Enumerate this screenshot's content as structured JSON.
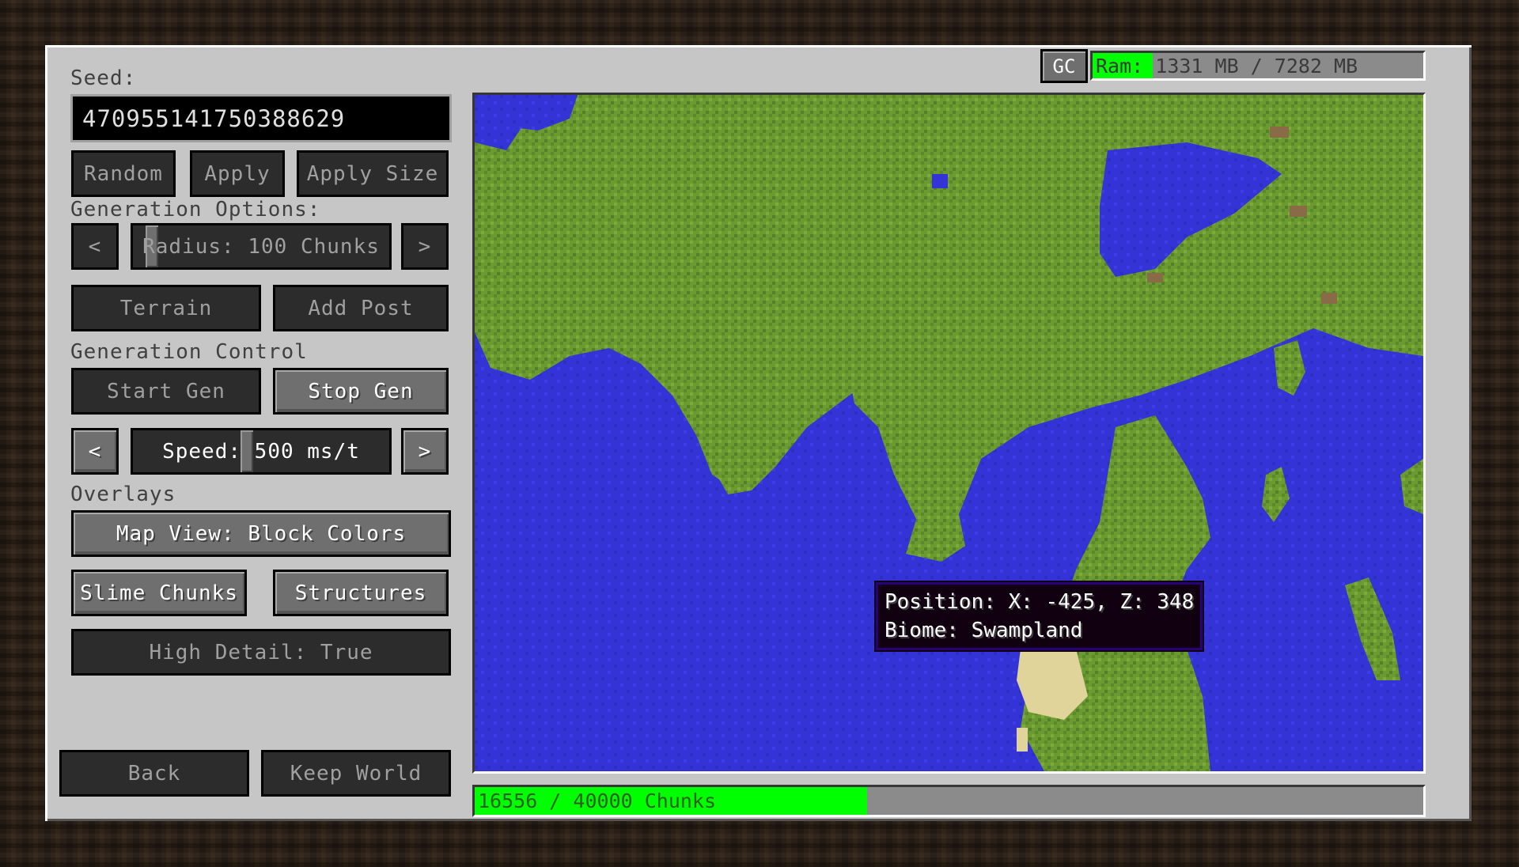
{
  "seed": {
    "label": "Seed:",
    "value": "4709551417503886​29"
  },
  "seed_buttons": {
    "random": "Random",
    "apply": "Apply",
    "apply_size": "Apply Size"
  },
  "generation_options": {
    "label": "Generation Options:",
    "prev": "<",
    "next": ">",
    "radius_label": "Radius: 100 Chunks",
    "radius_slider_fraction": 0.05,
    "terrain": "Terrain",
    "add_post": "Add Post"
  },
  "generation_control": {
    "label": "Generation Control",
    "start": "Start Gen",
    "stop": "Stop Gen",
    "prev": "<",
    "next": ">",
    "speed_label": "Speed: 500 ms/t",
    "speed_slider_fraction": 0.42
  },
  "overlays": {
    "label": "Overlays",
    "map_view": "Map View: Block Colors",
    "slime_chunks": "Slime Chunks",
    "structures": "Structures",
    "high_detail": "High Detail: True"
  },
  "footer": {
    "back": "Back",
    "keep_world": "Keep World"
  },
  "memory": {
    "gc_label": "GC",
    "ram_label": "Ram:",
    "ram_text": "1331 MB / 7282 MB",
    "used_mb": 1331,
    "total_mb": 7282
  },
  "progress": {
    "text": "16556 / 40000 Chunks",
    "done": 16556,
    "total": 40000
  },
  "tooltip": {
    "position": "Position: X: -425, Z: 348",
    "biome": "Biome: Swampland"
  },
  "colors": {
    "progress_fill": "#00ff00",
    "water": "#3434d6",
    "grass": "#6a9a30",
    "grass_light": "#7cab3c",
    "grass_dark": "#55802a",
    "sand": "#e0d49a"
  }
}
